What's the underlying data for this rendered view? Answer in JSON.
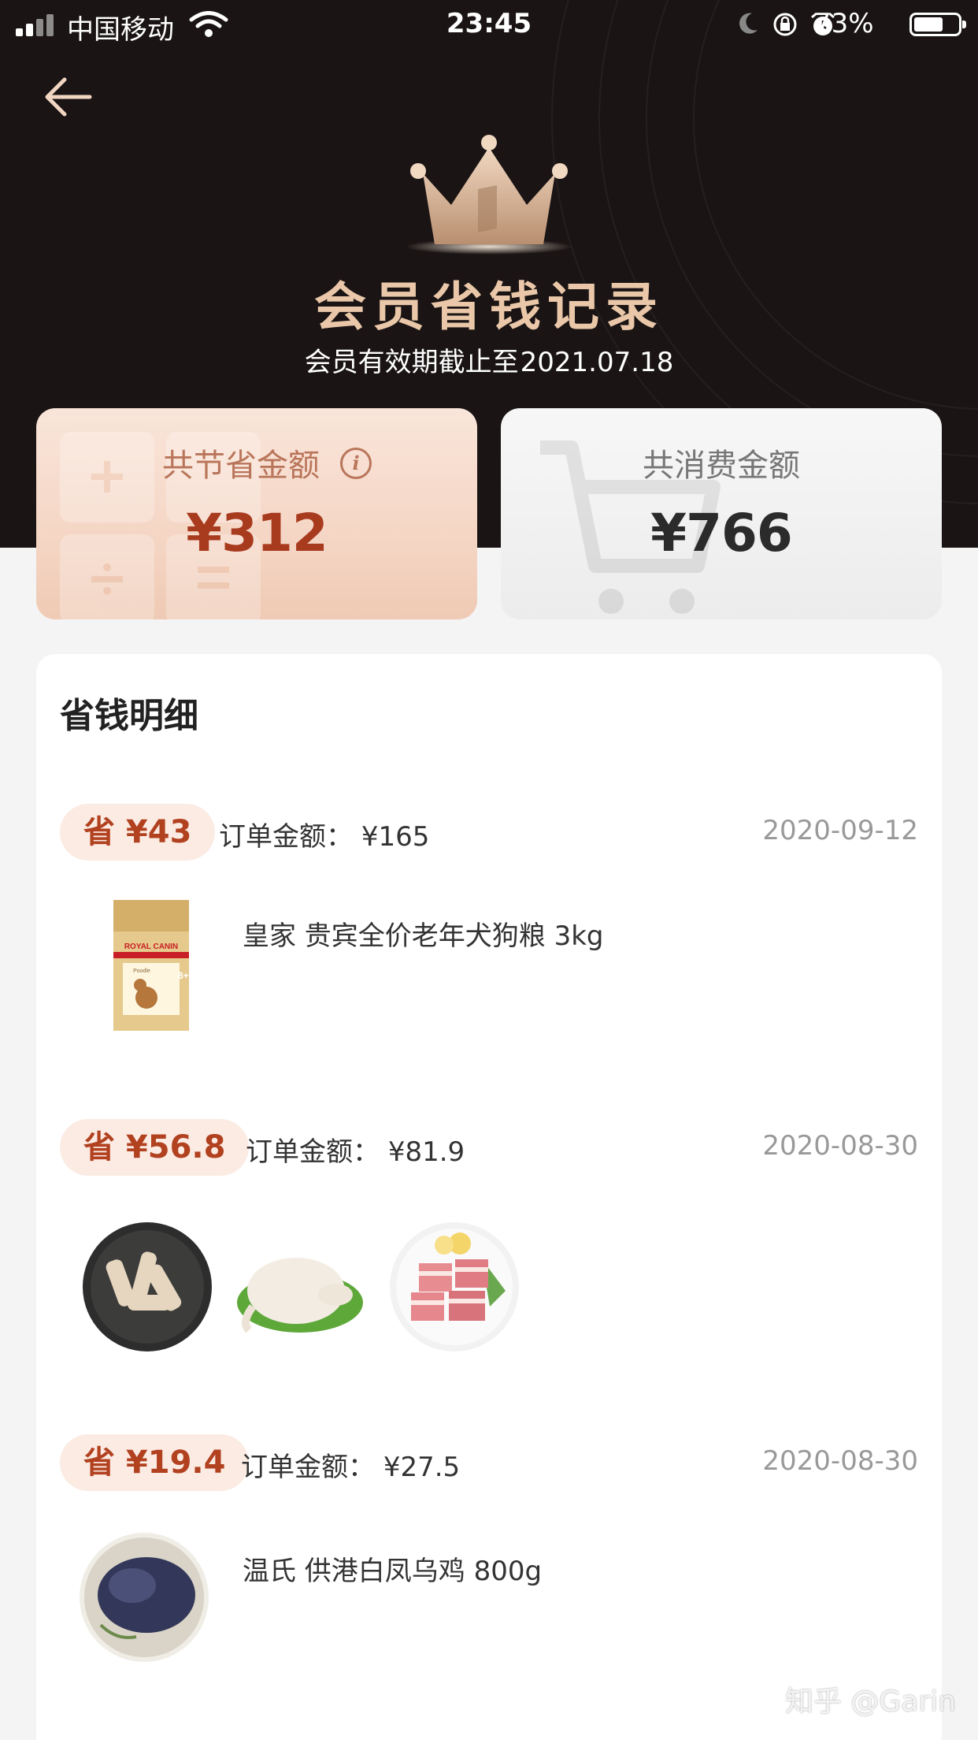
{
  "status_bar": {
    "carrier": "中国移动",
    "time": "23:45",
    "battery": "73%"
  },
  "header": {
    "title": "会员省钱记录",
    "validity_prefix": "会员有效期截止至",
    "validity_date": "2021.07.18"
  },
  "summary": {
    "savings_label": "共节省金额",
    "savings_amount": "¥312",
    "spend_label": "共消费金额",
    "spend_amount": "¥766"
  },
  "details": {
    "title": "省钱明细",
    "orders": [
      {
        "saved": "省 ¥43",
        "order_label": "订单金额：",
        "order_amount": "¥165",
        "date": "2020-09-12",
        "product_name": "皇家 贵宾全价老年犬狗粮 3kg",
        "product_text": [
          "ROYAL CANIN",
          "Poodle",
          "8+"
        ]
      },
      {
        "saved": "省 ¥56.8",
        "order_label": "订单金额：",
        "order_amount": "¥81.9",
        "date": "2020-08-30"
      },
      {
        "saved": "省 ¥19.4",
        "order_label": "订单金额：",
        "order_amount": "¥27.5",
        "date": "2020-08-30",
        "product_name": "温氏 供港白凤乌鸡 800g"
      }
    ]
  },
  "watermark": "知乎 @Garin",
  "colors": {
    "hero_bg": "#1a1414",
    "title_gold": "#e9c7a8",
    "save_red": "#b1411f",
    "badge_bg": "#fbebe3"
  }
}
